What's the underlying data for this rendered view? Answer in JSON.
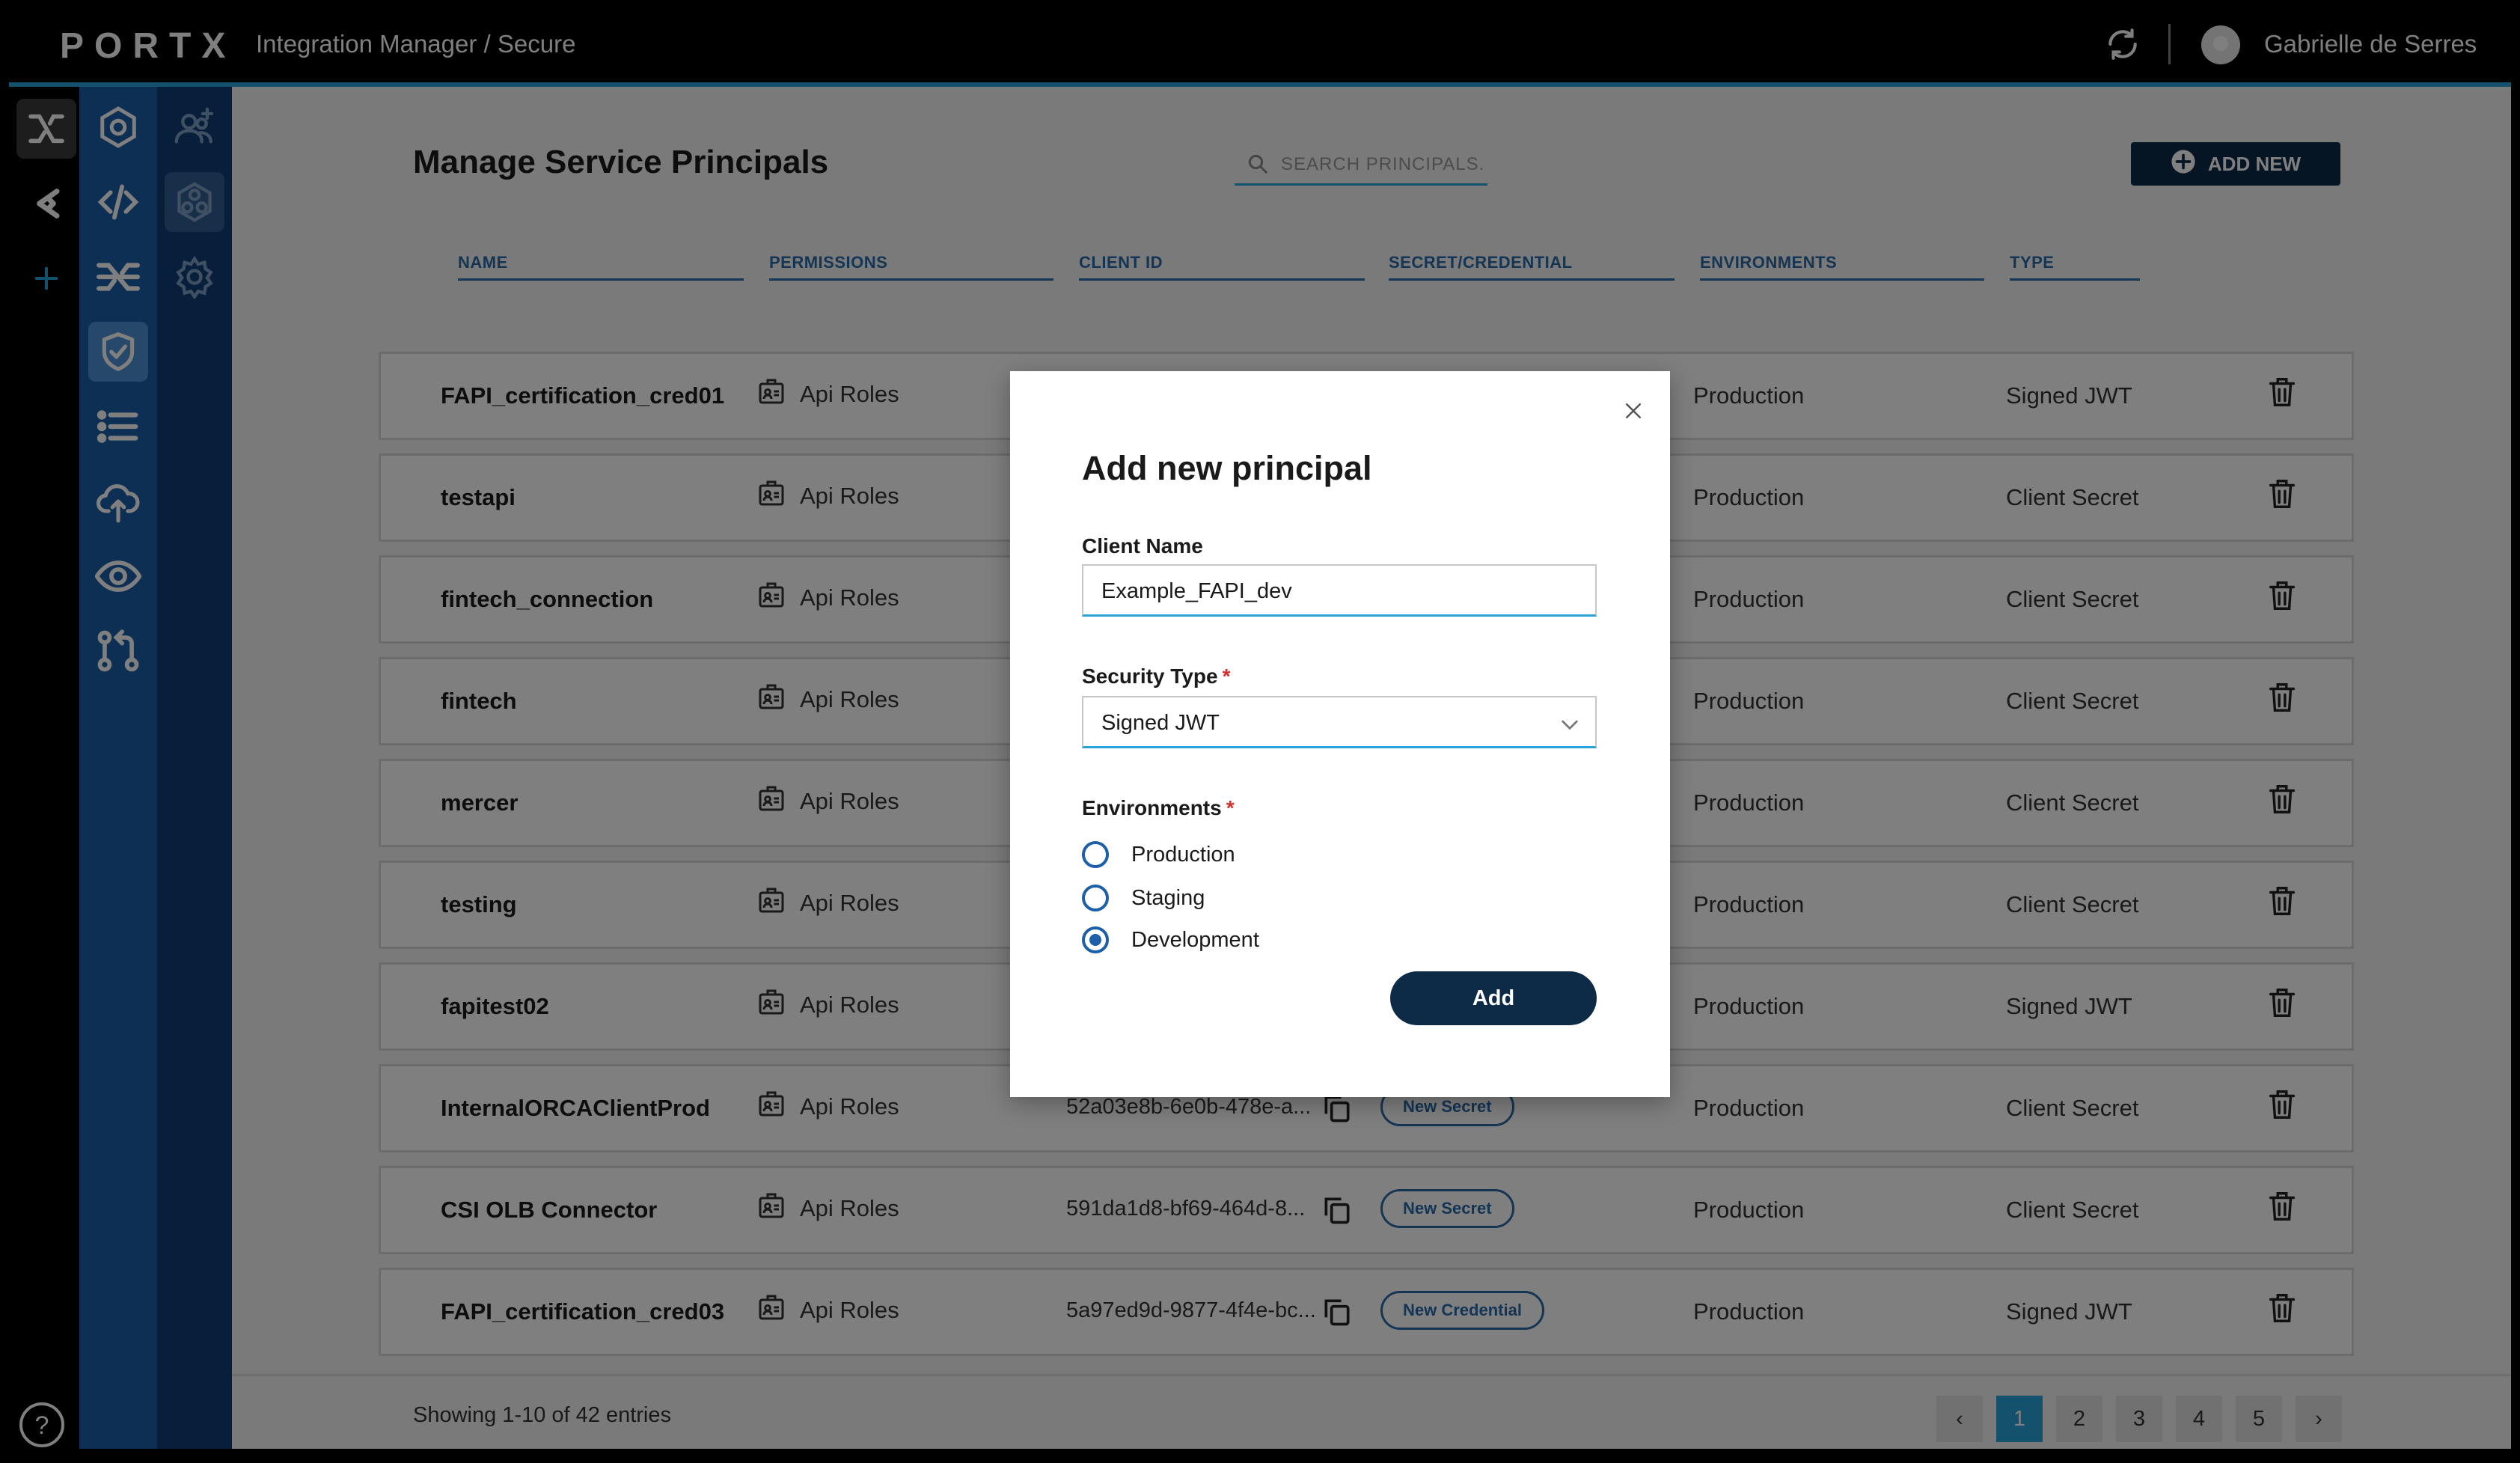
{
  "app": {
    "logo": "PORTX",
    "breadcrumb": "Integration Manager / Secure",
    "user_name": "Gabrielle de Serres",
    "accent_color": "#29a3d8",
    "brand_dark": "#0d2a47"
  },
  "page": {
    "title": "Manage Service Principals",
    "search_placeholder": "SEARCH PRINCIPALS...",
    "add_new_label": "ADD NEW"
  },
  "columns": [
    "NAME",
    "PERMISSIONS",
    "CLIENT ID",
    "SECRET/CREDENTIAL",
    "ENVIRONMENTS",
    "TYPE"
  ],
  "rows": [
    {
      "name": "FAPI_certification_cred01",
      "permissions": "Api Roles",
      "client_id": "",
      "secret_label": "",
      "environment": "Production",
      "type": "Signed JWT"
    },
    {
      "name": "testapi",
      "permissions": "Api Roles",
      "client_id": "",
      "secret_label": "",
      "environment": "Production",
      "type": "Client Secret"
    },
    {
      "name": "fintech_connection",
      "permissions": "Api Roles",
      "client_id": "",
      "secret_label": "",
      "environment": "Production",
      "type": "Client Secret"
    },
    {
      "name": "fintech",
      "permissions": "Api Roles",
      "client_id": "",
      "secret_label": "",
      "environment": "Production",
      "type": "Client Secret"
    },
    {
      "name": "mercer",
      "permissions": "Api Roles",
      "client_id": "",
      "secret_label": "",
      "environment": "Production",
      "type": "Client Secret"
    },
    {
      "name": "testing",
      "permissions": "Api Roles",
      "client_id": "",
      "secret_label": "",
      "environment": "Production",
      "type": "Client Secret"
    },
    {
      "name": "fapitest02",
      "permissions": "Api Roles",
      "client_id": "",
      "secret_label": "",
      "environment": "Production",
      "type": "Signed JWT"
    },
    {
      "name": "InternalORCAClientProd",
      "permissions": "Api Roles",
      "client_id": "52a03e8b-6e0b-478e-a...",
      "secret_label": "New Secret",
      "environment": "Production",
      "type": "Client Secret"
    },
    {
      "name": "CSI OLB Connector",
      "permissions": "Api Roles",
      "client_id": "591da1d8-bf69-464d-8...",
      "secret_label": "New Secret",
      "environment": "Production",
      "type": "Client Secret"
    },
    {
      "name": "FAPI_certification_cred03",
      "permissions": "Api Roles",
      "client_id": "5a97ed9d-9877-4f4e-bc...",
      "secret_label": "New Credential",
      "environment": "Production",
      "type": "Signed JWT"
    }
  ],
  "pagination": {
    "info": "Showing 1-10 of 42 entries",
    "pages": [
      "1",
      "2",
      "3",
      "4",
      "5"
    ],
    "current": "1",
    "prev": "‹",
    "next": "›"
  },
  "modal": {
    "title": "Add new principal",
    "client_name_label": "Client Name",
    "client_name_value": "Example_FAPI_dev",
    "security_type_label": "Security Type",
    "security_type_value": "Signed JWT",
    "environments_label": "Environments",
    "required_mark": "*",
    "environments": [
      {
        "label": "Production",
        "selected": false
      },
      {
        "label": "Staging",
        "selected": false
      },
      {
        "label": "Development",
        "selected": true
      }
    ],
    "add_label": "Add",
    "close_glyph": "×"
  },
  "icons": [
    "portx-logo",
    "refresh-icon",
    "avatar",
    "hexagon-icon",
    "code-icon",
    "shuffle-icon",
    "shield-check-icon",
    "list-icon",
    "cloud-upload-icon",
    "eye-icon",
    "git-pull-icon",
    "add-user-icon",
    "cluster-icon",
    "gear-icon",
    "plus-icon",
    "help-icon",
    "search-icon",
    "id-card-icon",
    "copy-icon",
    "trash-icon",
    "chevron-down-icon",
    "close-icon"
  ]
}
